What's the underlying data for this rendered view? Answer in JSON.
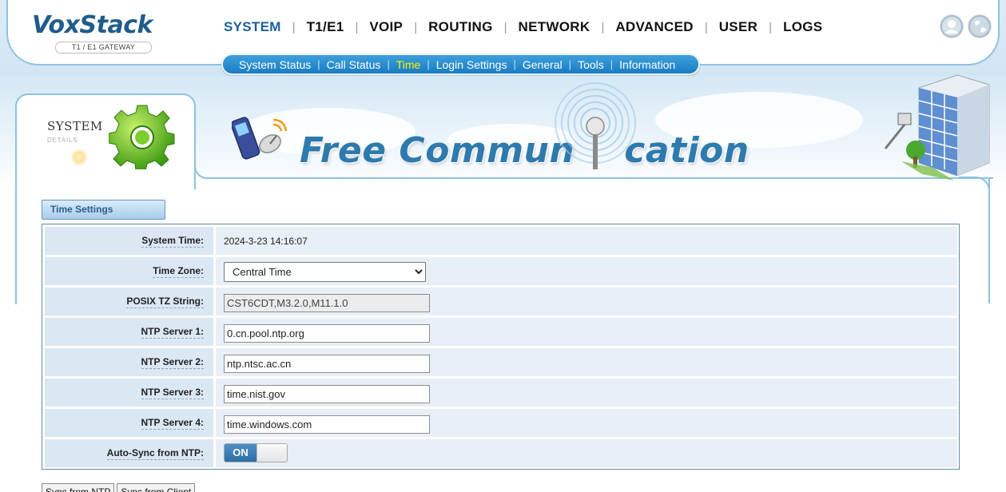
{
  "header": {
    "logo": "VoxStack",
    "logo_sub": "T1 / E1 GATEWAY",
    "nav": [
      "SYSTEM",
      "T1/E1",
      "VOIP",
      "ROUTING",
      "NETWORK",
      "ADVANCED",
      "USER",
      "LOGS"
    ],
    "nav_active": "SYSTEM",
    "sub_nav": [
      "System Status",
      "Call Status",
      "Time",
      "Login Settings",
      "General",
      "Tools",
      "Information"
    ],
    "sub_nav_active": "Time",
    "icons": [
      "user-icon",
      "globe-icon"
    ]
  },
  "banner": {
    "side_title": "SYSTEM",
    "side_sub": "DETAILS",
    "text_left": "Free Commun",
    "text_right": "cation"
  },
  "section": {
    "title": "Time Settings"
  },
  "fields": {
    "system_time": {
      "label": "System Time:",
      "value": "2024-3-23 14:16:07"
    },
    "time_zone": {
      "label": "Time Zone:",
      "value": "Central Time"
    },
    "posix": {
      "label": "POSIX TZ String:",
      "value": "CST6CDT,M3.2.0,M11.1.0"
    },
    "ntp1": {
      "label": "NTP Server 1:",
      "value": "0.cn.pool.ntp.org"
    },
    "ntp2": {
      "label": "NTP Server 2:",
      "value": "ntp.ntsc.ac.cn"
    },
    "ntp3": {
      "label": "NTP Server 3:",
      "value": "time.nist.gov"
    },
    "ntp4": {
      "label": "NTP Server 4:",
      "value": "time.windows.com"
    },
    "autosync": {
      "label": "Auto-Sync from NTP:",
      "value": "ON"
    }
  },
  "buttons": {
    "sync_ntp": "Sync from NTP",
    "sync_client": "Sync from Client"
  },
  "colors": {
    "accent": "#1c5f9a",
    "subnav": "#1a7cc2",
    "active_subnav": "#fff200",
    "label_bg": "#dbe7f3"
  }
}
